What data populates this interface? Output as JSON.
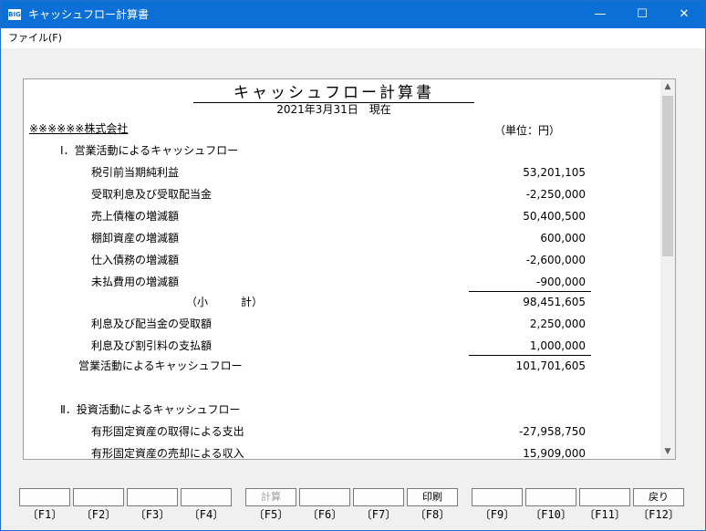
{
  "window": {
    "app_icon_text": "BIG",
    "title": "キャッシュフロー計算書",
    "minimize_glyph": "—",
    "maximize_glyph": "☐",
    "close_glyph": "✕"
  },
  "menu": {
    "file": "ファイル(F)"
  },
  "report": {
    "title": "キャッシュフロー計算書",
    "date": "2021年3月31日　現在",
    "company": "※※※※※※株式会社",
    "unit": "（単位：円）",
    "rows": [
      {
        "label": "Ⅰ．営業活動によるキャッシュフロー",
        "value": ""
      },
      {
        "label": "税引前当期純利益",
        "value": "53,201,105"
      },
      {
        "label": "受取利息及び受取配当金",
        "value": "-2,250,000"
      },
      {
        "label": "売上債権の増減額",
        "value": "50,400,500"
      },
      {
        "label": "棚卸資産の増減額",
        "value": "600,000"
      },
      {
        "label": "仕入債務の増減額",
        "value": "-2,600,000"
      },
      {
        "label": "未払費用の増減額",
        "value": "-900,000"
      },
      {
        "label": "（小　　　計）",
        "value": "98,451,605"
      },
      {
        "label": "利息及び配当金の受取額",
        "value": "2,250,000"
      },
      {
        "label": "利息及び割引料の支払額",
        "value": "1,000,000"
      },
      {
        "label": "営業活動によるキャッシュフロー",
        "value": "101,701,605"
      },
      {
        "label": "Ⅱ．投資活動によるキャッシュフロー",
        "value": ""
      },
      {
        "label": "有形固定資産の取得による支出",
        "value": "-27,958,750"
      },
      {
        "label": "有形固定資産の売却による収入",
        "value": "15,909,000"
      }
    ]
  },
  "scrollbar": {
    "up_glyph": "▲",
    "down_glyph": "▼"
  },
  "fkeys": [
    {
      "button": "",
      "label": "〔F1〕"
    },
    {
      "button": "",
      "label": "〔F2〕"
    },
    {
      "button": "",
      "label": "〔F3〕"
    },
    {
      "button": "",
      "label": "〔F4〕"
    },
    {
      "button": "計算",
      "label": "〔F5〕"
    },
    {
      "button": "",
      "label": "〔F6〕"
    },
    {
      "button": "",
      "label": "〔F7〕"
    },
    {
      "button": "印刷",
      "label": "〔F8〕"
    },
    {
      "button": "",
      "label": "〔F9〕"
    },
    {
      "button": "",
      "label": "〔F10〕"
    },
    {
      "button": "",
      "label": "〔F11〕"
    },
    {
      "button": "戻り",
      "label": "〔F12〕"
    }
  ]
}
